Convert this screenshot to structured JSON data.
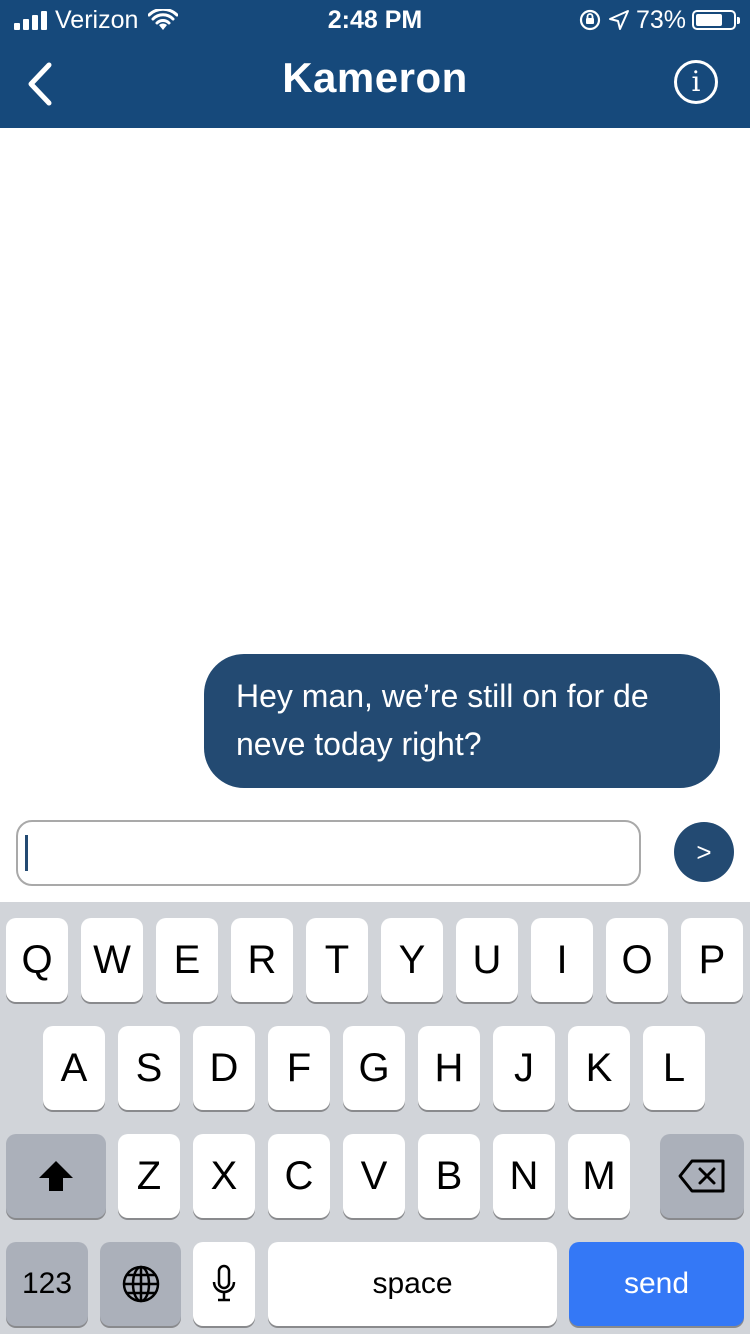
{
  "status_bar": {
    "carrier": "Verizon",
    "time": "2:48 PM",
    "battery_percent": "73%",
    "battery_level": 0.73,
    "icons": [
      "signal-bars-icon",
      "wifi-icon",
      "rotation-lock-icon",
      "location-arrow-icon",
      "battery-icon"
    ]
  },
  "nav": {
    "back_icon": "chevron-left-icon",
    "title": "Kameron",
    "info_icon": "info-circle-icon",
    "info_glyph": "i"
  },
  "messages": [
    {
      "text": "Hey man, we’re still on for de neve today right?",
      "direction": "outgoing"
    }
  ],
  "composer": {
    "input_value": "",
    "send_label": ">"
  },
  "keyboard": {
    "row1": [
      "Q",
      "W",
      "E",
      "R",
      "T",
      "Y",
      "U",
      "I",
      "O",
      "P"
    ],
    "row2": [
      "A",
      "S",
      "D",
      "F",
      "G",
      "H",
      "J",
      "K",
      "L"
    ],
    "row3": [
      "Z",
      "X",
      "C",
      "V",
      "B",
      "N",
      "M"
    ],
    "numbers_label": "123",
    "space_label": "space",
    "return_label": "send",
    "shift_icon": "shift-arrow-icon",
    "delete_icon": "backspace-icon",
    "globe_icon": "globe-icon",
    "mic_icon": "microphone-icon"
  },
  "colors": {
    "header_bg": "#16497b",
    "bubble_bg": "#234a72",
    "keyboard_bg": "#d1d4d9",
    "send_key_bg": "#3478f6"
  }
}
